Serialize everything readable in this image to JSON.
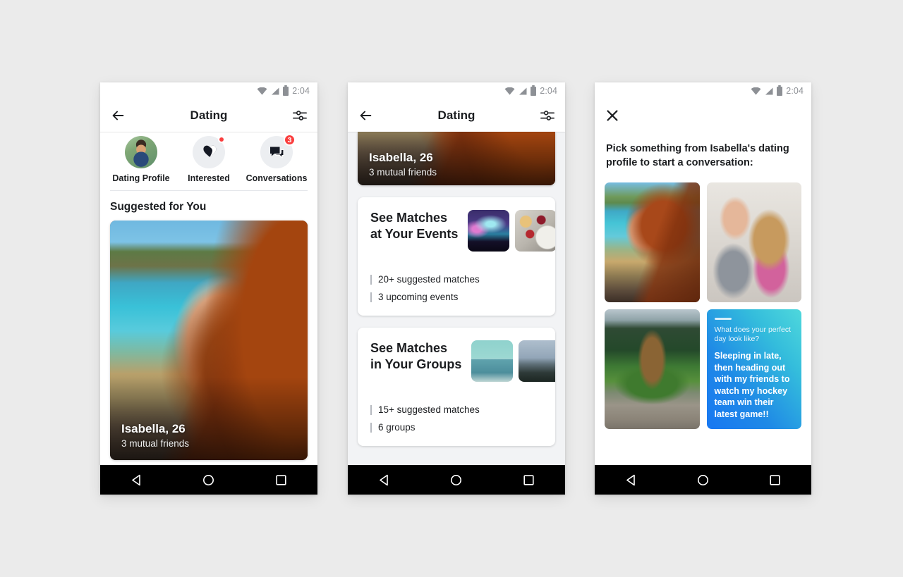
{
  "statusbar": {
    "time": "2:04",
    "wifi_icon": "wifi-icon",
    "signal_icon": "signal-icon",
    "battery_icon": "battery-icon"
  },
  "navbar": {
    "back": "back-triangle-icon",
    "home": "home-circle-icon",
    "recents": "recents-square-icon"
  },
  "phone1": {
    "appbar": {
      "back_icon": "back-arrow-icon",
      "title": "Dating",
      "settings_icon": "tuner-sliders-icon"
    },
    "shortcuts": [
      {
        "label": "Dating Profile",
        "icon": "avatar-photo",
        "badge": ""
      },
      {
        "label": "Interested",
        "icon": "double-heart-icon",
        "badge_dot": true
      },
      {
        "label": "Conversations",
        "icon": "chat-bubbles-icon",
        "badge": "3"
      }
    ],
    "section_title": "Suggested for You",
    "card": {
      "name": "Isabella, 26",
      "mutual": "3 mutual friends",
      "photo": "woman-at-beach-photo"
    }
  },
  "phone2": {
    "appbar": {
      "back_icon": "back-arrow-icon",
      "title": "Dating",
      "settings_icon": "tuner-sliders-icon"
    },
    "top_card": {
      "name": "Isabella, 26",
      "mutual": "3 mutual friends",
      "photo": "woman-at-beach-photo"
    },
    "cards": [
      {
        "title_line1": "See Matches",
        "title_line2": "at Your Events",
        "thumbs": [
          "concert-crowd-photo",
          "food-table-photo"
        ],
        "stats": [
          "20+ suggested matches",
          "3 upcoming events"
        ]
      },
      {
        "title_line1": "See Matches",
        "title_line2": "in Your Groups",
        "thumbs": [
          "glass-building-photo",
          "forest-coastline-photo"
        ],
        "stats": [
          "15+ suggested matches",
          "6 groups"
        ]
      }
    ]
  },
  "phone3": {
    "appbar": {
      "close_icon": "close-x-icon"
    },
    "prompt": "Pick something from Isabella's dating profile to start a conversation:",
    "tiles": [
      {
        "kind": "photo",
        "name": "woman-at-beach-photo"
      },
      {
        "kind": "photo",
        "name": "woman-with-dog-photo"
      },
      {
        "kind": "photo",
        "name": "bear-statue-photo"
      },
      {
        "kind": "answer",
        "question": "What does your perfect day look like?",
        "answer": "Sleeping in late, then heading out with my friends to watch my hockey team win their latest game!!"
      }
    ]
  },
  "colors": {
    "accent": "#1877f2",
    "badge": "#fa3e3e",
    "text": "#1c1e21",
    "muted": "#8d9095",
    "page_bg": "#ebebeb"
  }
}
